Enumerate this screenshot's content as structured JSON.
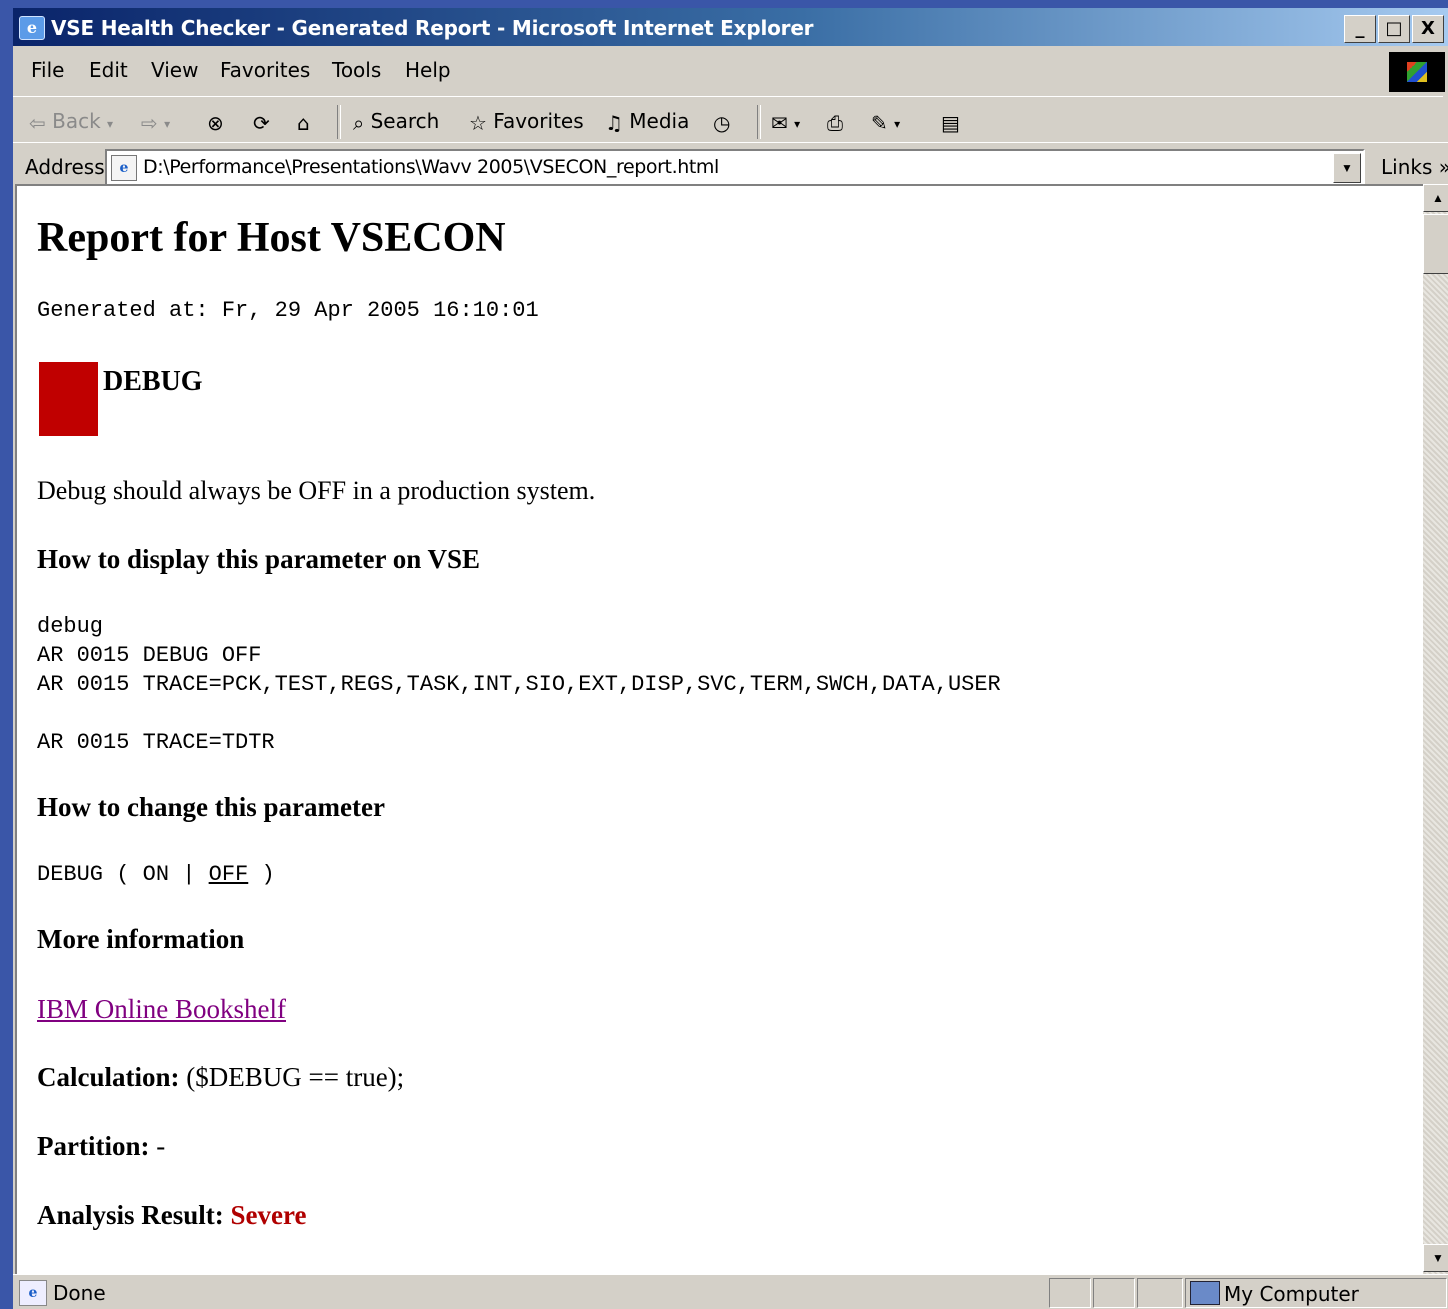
{
  "window": {
    "title": "VSE Health Checker - Generated Report - Microsoft Internet Explorer",
    "buttons": {
      "minimize": "_",
      "maximize": "□",
      "close": "X"
    }
  },
  "menu": [
    "File",
    "Edit",
    "View",
    "Favorites",
    "Tools",
    "Help"
  ],
  "toolbar": {
    "back": "Back",
    "search": "Search",
    "favorites": "Favorites",
    "media": "Media"
  },
  "address": {
    "label": "Address",
    "url": "D:\\Performance\\Presentations\\Wavv 2005\\VSECON_report.html",
    "links": "Links »"
  },
  "report": {
    "title": "Report for Host VSECON",
    "generated": "Generated at: Fr, 29 Apr 2005 16:10:01",
    "parameter": "DEBUG",
    "severity_color": "#c00000",
    "description": "Debug should always be OFF in a production system.",
    "display_heading": "How to display this parameter on VSE",
    "display_lines": [
      "debug",
      "AR 0015 DEBUG OFF",
      "AR 0015 TRACE=PCK,TEST,REGS,TASK,INT,SIO,EXT,DISP,SVC,TERM,SWCH,DATA,USER",
      "AR 0015 TRACE=TDTR"
    ],
    "change_heading": "How to change this parameter",
    "change_syntax": {
      "prefix": "DEBUG ( ON | ",
      "default": "OFF",
      "suffix": " )"
    },
    "more_heading": "More information",
    "more_link": "IBM Online Bookshelf",
    "calculation_label": "Calculation:",
    "calculation_value": "($DEBUG == true);",
    "partition_label": "Partition:",
    "partition_value": "-",
    "result_label": "Analysis Result:",
    "result_value": "Severe"
  },
  "status": {
    "text": "Done",
    "zone": "My Computer"
  }
}
